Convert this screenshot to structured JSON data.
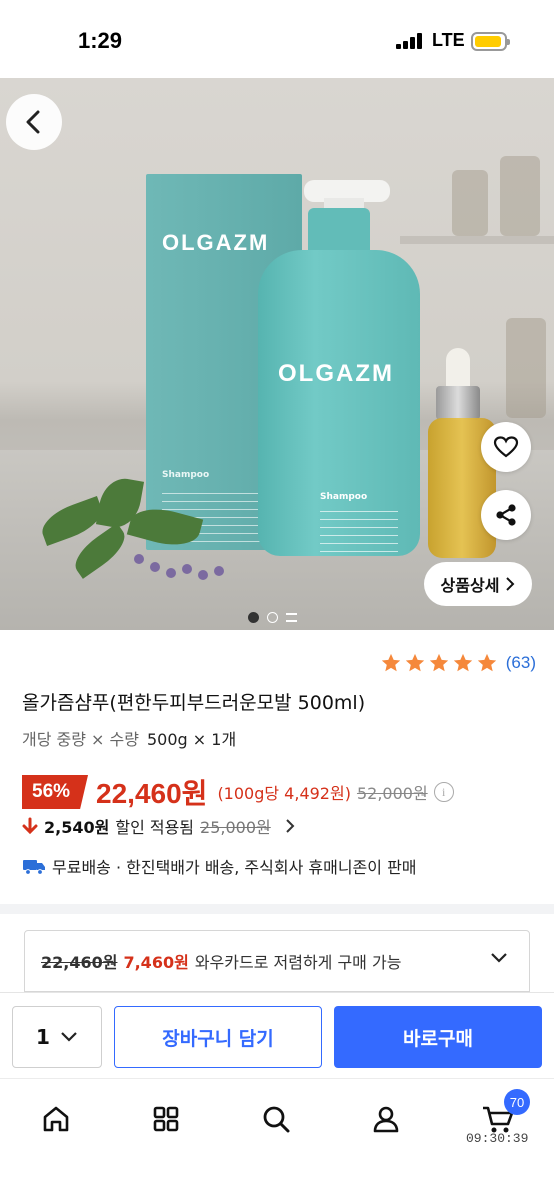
{
  "status_bar": {
    "time": "1:29",
    "network": "LTE",
    "battery_color": "#ffcc00"
  },
  "hero": {
    "box_brand": "OLGAZM",
    "box_label": "Shampoo",
    "bottle_brand": "OLGAZM",
    "bottle_label": "Shampoo",
    "detail_button": "상품상세",
    "slide_count": 3,
    "active_slide": 1
  },
  "product": {
    "rating_stars": 5,
    "rating_count": "(63)",
    "title": "올가즘샴푸(편한두피부드러운모발 500ml)",
    "option_label": "개당 중량 × 수량",
    "option_value": "500g × 1개",
    "discount_badge": "56%",
    "price": "22,460원",
    "unit_price": "(100g당 4,492원)",
    "original_price": "52,000원",
    "coupon_amount": "2,540원",
    "coupon_text": "할인 적용됨",
    "coupon_original": "25,000원",
    "shipping": "무료배송 · 한진택배가 배송, 주식회사 휴매니존이 판매"
  },
  "wow": {
    "strike_price": "22,460원",
    "price": "7,460원",
    "text": "와우카드로 저렴하게 구매 가능"
  },
  "buy_bar": {
    "quantity": "1",
    "cart_label": "장바구니 담기",
    "buy_label": "바로구매"
  },
  "tab_bar": {
    "cart_badge": "70",
    "clock": "09:30:39"
  },
  "colors": {
    "accent_blue": "#346aff",
    "sale_red": "#d5311a",
    "star_orange": "#f5883b",
    "link_blue": "#2c6fd8"
  }
}
